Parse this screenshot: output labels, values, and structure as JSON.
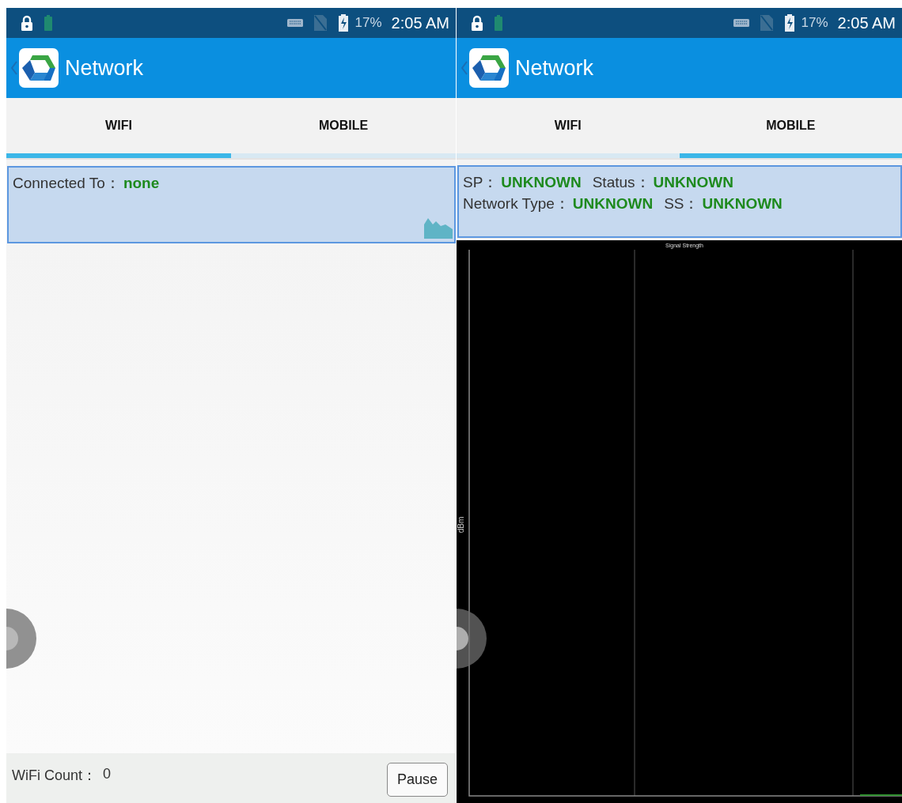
{
  "screens": [
    {
      "kind": "wifi",
      "status_bar": {
        "battery": "17%",
        "time": "2:05 AM"
      },
      "app_bar": {
        "title": "Network"
      },
      "tabs": [
        {
          "label": "WIFI",
          "selected": true
        },
        {
          "label": "MOBILE",
          "selected": false
        }
      ],
      "info_lines": [
        [
          {
            "label": "Connected To：",
            "value": "none"
          }
        ]
      ],
      "footer": {
        "count_label": "WiFi Count：",
        "count": "0",
        "button": "Pause"
      }
    },
    {
      "kind": "mobile",
      "status_bar": {
        "battery": "17%",
        "time": "2:05 AM"
      },
      "app_bar": {
        "title": "Network"
      },
      "tabs": [
        {
          "label": "WIFI",
          "selected": false
        },
        {
          "label": "MOBILE",
          "selected": true
        }
      ],
      "info_lines": [
        [
          {
            "label": "SP：",
            "value": "UNKNOWN"
          },
          {
            "label": "Status：",
            "value": "UNKNOWN"
          }
        ],
        [
          {
            "label": "Network Type：",
            "value": "UNKNOWN"
          },
          {
            "label": "SS：",
            "value": "UNKNOWN"
          }
        ]
      ],
      "chart": {
        "title": "Signal Strength",
        "ylabel": "dBm"
      }
    }
  ]
}
